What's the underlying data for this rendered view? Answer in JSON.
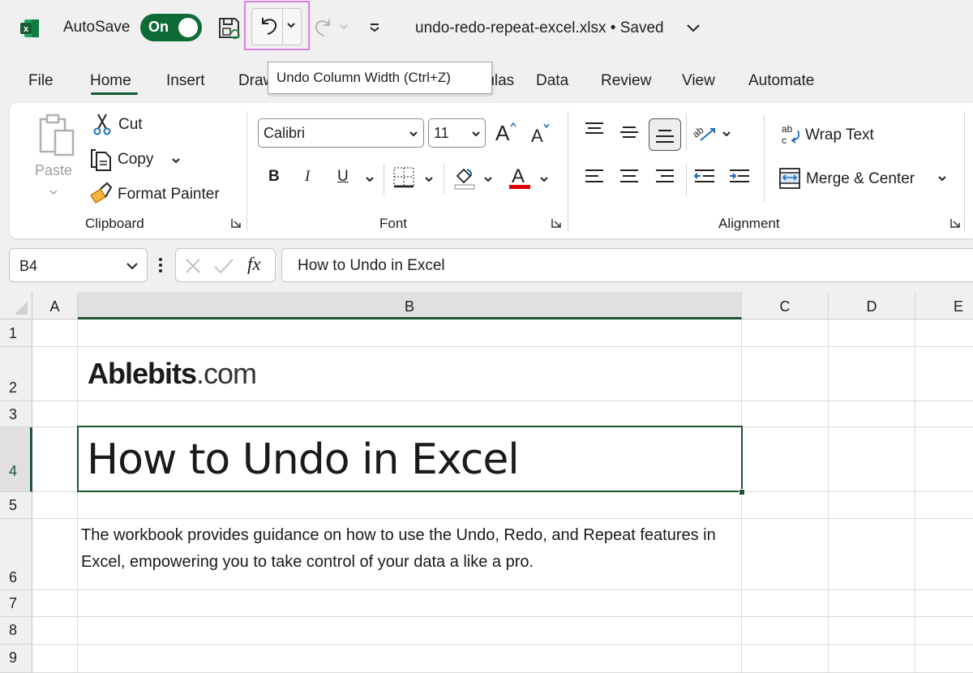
{
  "titlebar": {
    "app_icon": "excel-logo-icon",
    "autosave_label": "AutoSave",
    "autosave_state": "On",
    "save_icon": "save-sync-icon",
    "undo_icon": "undo-icon",
    "redo_icon": "redo-icon",
    "customize_icon": "customize-quick-access-icon",
    "file_title": "undo-redo-repeat-excel.xlsx • Saved"
  },
  "tooltip": {
    "text": "Undo Column Width (Ctrl+Z)"
  },
  "tabs": [
    {
      "label": "File",
      "active": false
    },
    {
      "label": "Home",
      "active": true
    },
    {
      "label": "Insert",
      "active": false
    },
    {
      "label": "Draw",
      "active": false
    },
    {
      "label": "Formulas",
      "active": false
    },
    {
      "label": "Data",
      "active": false
    },
    {
      "label": "Review",
      "active": false
    },
    {
      "label": "View",
      "active": false
    },
    {
      "label": "Automate",
      "active": false
    }
  ],
  "ribbon": {
    "clipboard": {
      "label": "Clipboard",
      "paste": "Paste",
      "cut": "Cut",
      "copy": "Copy",
      "format_painter": "Format Painter"
    },
    "font": {
      "label": "Font",
      "font_name": "Calibri",
      "font_size": "11",
      "bold": "B",
      "italic": "I",
      "underline": "U",
      "font_color_hex": "#e00000"
    },
    "alignment": {
      "label": "Alignment",
      "wrap_text": "Wrap Text",
      "merge_center": "Merge & Center"
    }
  },
  "formula_bar": {
    "name_box": "B4",
    "fx": "fx",
    "value": "How to Undo in Excel"
  },
  "grid": {
    "columns": [
      "A",
      "B",
      "C",
      "D",
      "E"
    ],
    "selected_column": "B",
    "rows": [
      "1",
      "2",
      "3",
      "4",
      "5",
      "6",
      "7",
      "8",
      "9"
    ],
    "selected_row": "4",
    "cells": {
      "B2_logo_main": "Ablebits",
      "B2_logo_suffix": ".com",
      "B4": "How to Undo in Excel",
      "B6": "The workbook provides guidance on how to use the Undo, Redo, and Repeat features in Excel, empowering you to take control of your data a like a pro."
    }
  },
  "colors": {
    "accent_green": "#0e6b36",
    "selection_green": "#1d5431",
    "highlight_pink": "#d97fe0"
  }
}
